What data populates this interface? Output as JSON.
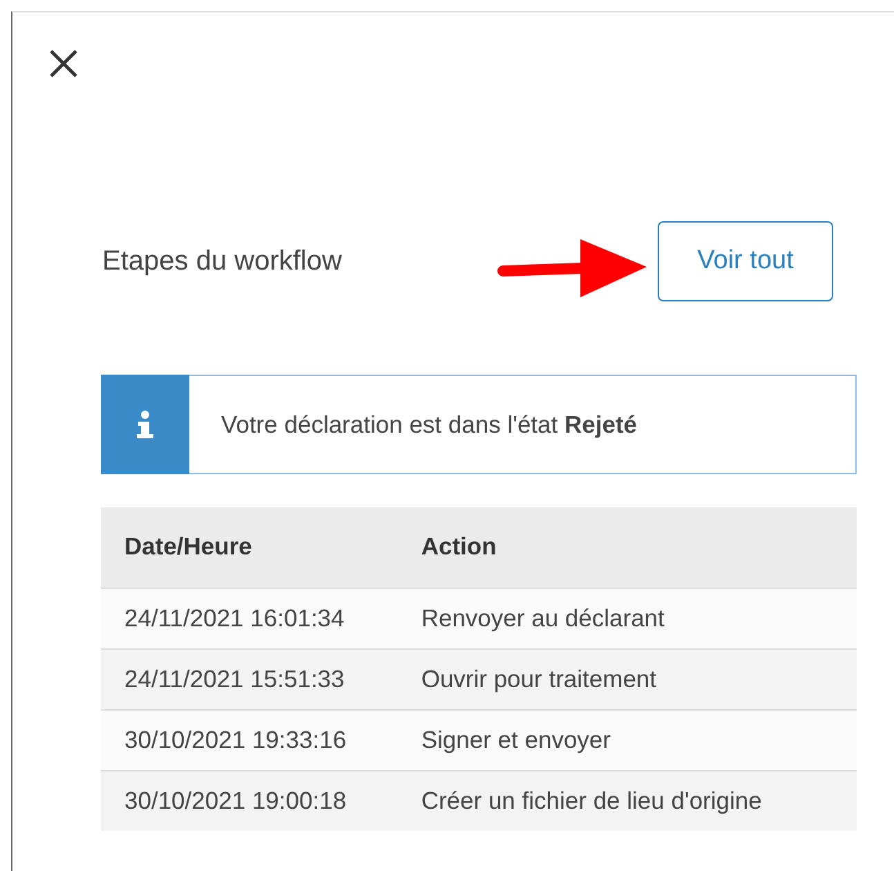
{
  "title": "Etapes du workflow",
  "view_all_button": "Voir tout",
  "info": {
    "text": "Votre déclaration est dans l'état **Rejeté**"
  },
  "table": {
    "columns": [
      "Date/Heure",
      "Action"
    ],
    "rows": [
      {
        "date": "24/11/2021 16:01:34",
        "action": "Renvoyer au déclarant"
      },
      {
        "date": "24/11/2021 15:51:33",
        "action": "Ouvrir pour traitement"
      },
      {
        "date": "30/10/2021 19:33:16",
        "action": "Signer et envoyer"
      },
      {
        "date": "30/10/2021 19:00:18",
        "action": "Créer un fichier de lieu d'origine"
      }
    ]
  }
}
